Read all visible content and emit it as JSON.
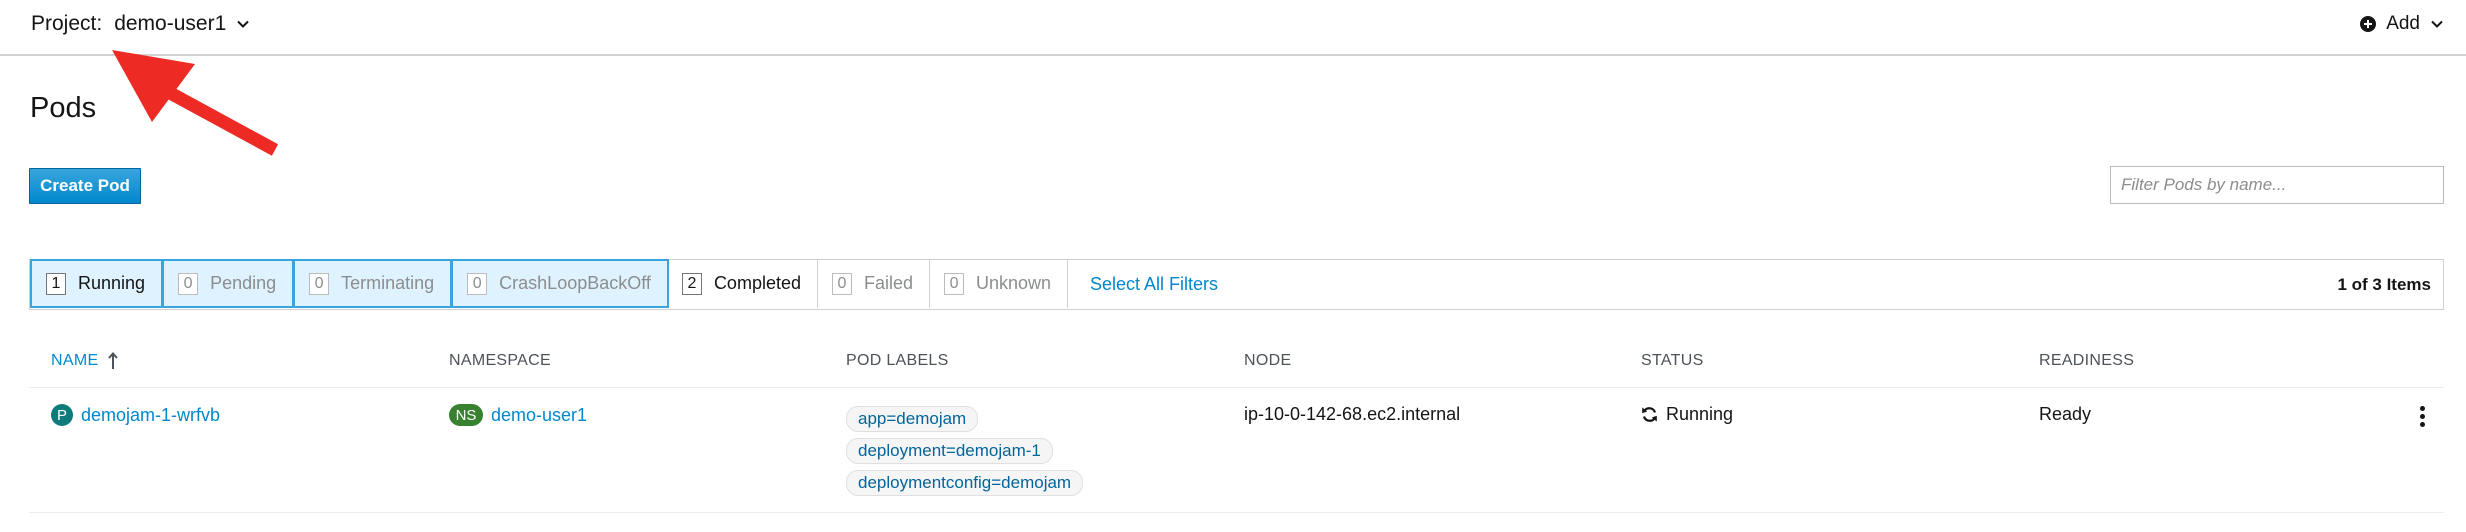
{
  "topbar": {
    "project_label": "Project:",
    "project_name": "demo-user1",
    "add_label": "Add"
  },
  "page": {
    "title": "Pods",
    "create_button": "Create Pod",
    "filter_placeholder": "Filter Pods by name..."
  },
  "filters": {
    "statuses": [
      {
        "count": "1",
        "label": "Running"
      },
      {
        "count": "0",
        "label": "Pending"
      },
      {
        "count": "0",
        "label": "Terminating"
      },
      {
        "count": "0",
        "label": "CrashLoopBackOff"
      },
      {
        "count": "2",
        "label": "Completed"
      },
      {
        "count": "0",
        "label": "Failed"
      },
      {
        "count": "0",
        "label": "Unknown"
      }
    ],
    "select_all": "Select All Filters",
    "item_count": "1 of 3 Items"
  },
  "table": {
    "headers": {
      "name": "NAME",
      "namespace": "NAMESPACE",
      "pod_labels": "POD LABELS",
      "node": "NODE",
      "status": "STATUS",
      "readiness": "READINESS"
    },
    "rows": [
      {
        "badge": "P",
        "name": "demojam-1-wrfvb",
        "ns_badge": "NS",
        "namespace": "demo-user1",
        "labels": [
          "app=demojam",
          "deployment=demojam-1",
          "deploymentconfig=demojam"
        ],
        "node": "ip-10-0-142-68.ec2.internal",
        "status": "Running",
        "readiness": "Ready"
      }
    ]
  },
  "colors": {
    "accent": "#0088ce",
    "annotation_arrow": "#ee2a24"
  }
}
